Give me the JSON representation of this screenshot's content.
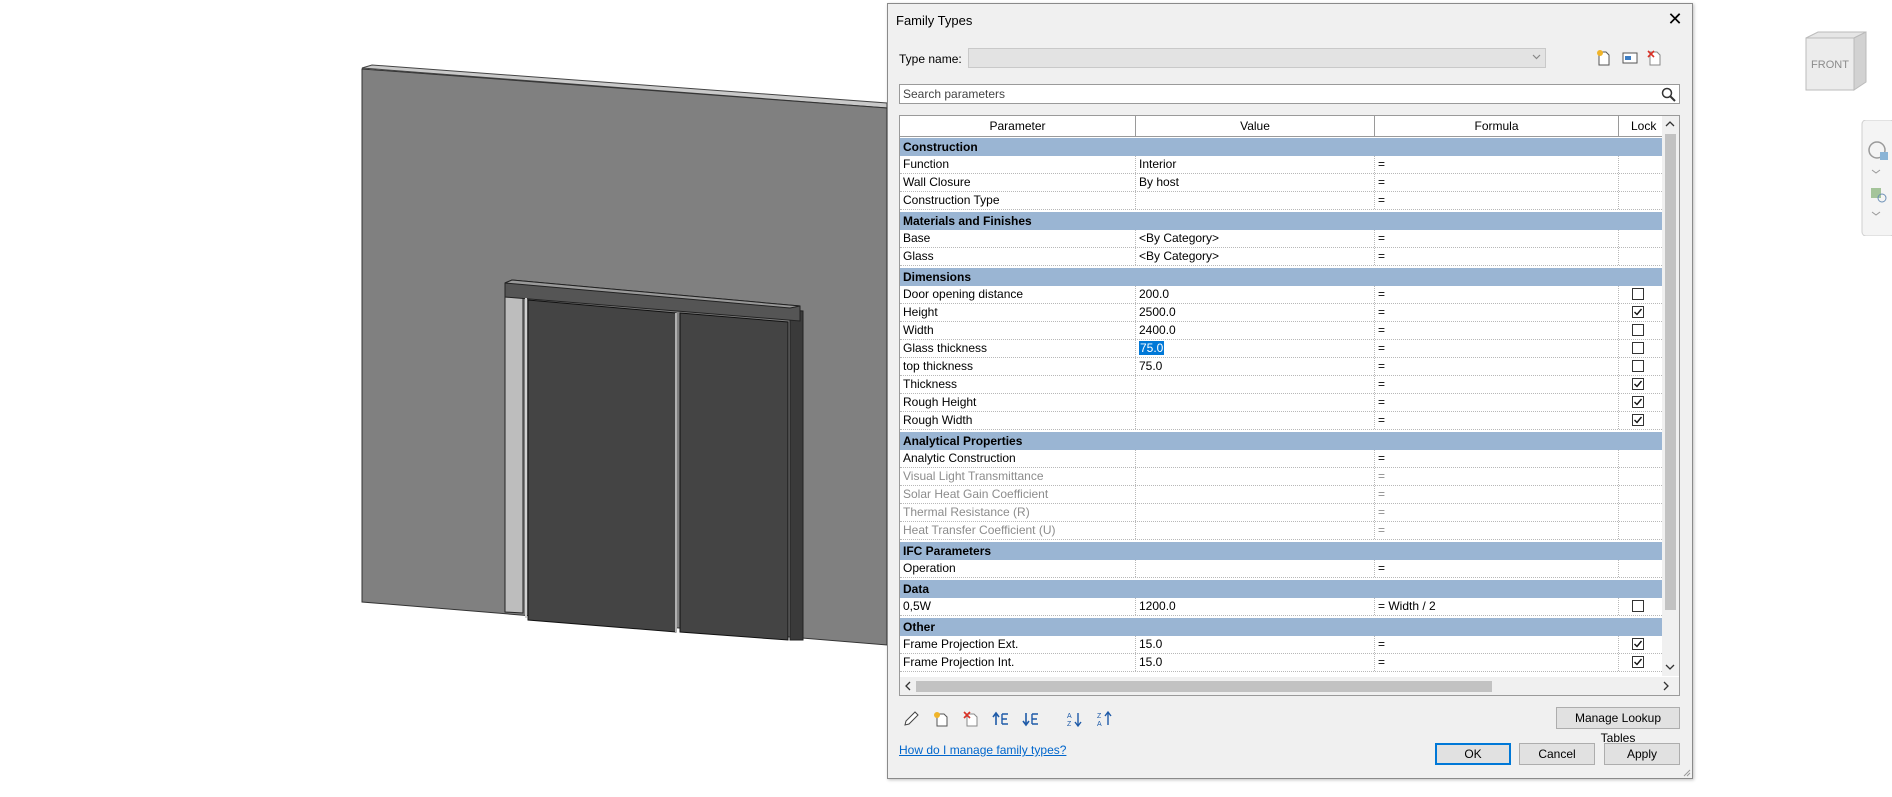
{
  "dialog": {
    "title": "Family Types",
    "type_name_label": "Type name:",
    "type_name_value": "",
    "search_placeholder": "Search parameters"
  },
  "table": {
    "columns": [
      "Parameter",
      "Value",
      "Formula",
      "Lock"
    ],
    "groups": [
      {
        "name": "Construction",
        "rows": [
          {
            "parameter": "Function",
            "value": "Interior",
            "formula": "=",
            "lock": null,
            "disabled": false
          },
          {
            "parameter": "Wall Closure",
            "value": "By host",
            "formula": "=",
            "lock": null,
            "disabled": false
          },
          {
            "parameter": "Construction Type",
            "value": "",
            "formula": "=",
            "lock": null,
            "disabled": false
          }
        ]
      },
      {
        "name": "Materials and Finishes",
        "rows": [
          {
            "parameter": "Base",
            "value": "<By Category>",
            "formula": "=",
            "lock": null,
            "disabled": false
          },
          {
            "parameter": "Glass",
            "value": "<By Category>",
            "formula": "=",
            "lock": null,
            "disabled": false
          }
        ]
      },
      {
        "name": "Dimensions",
        "rows": [
          {
            "parameter": "Door opening distance",
            "value": "200.0",
            "formula": "=",
            "lock": false,
            "disabled": false
          },
          {
            "parameter": "Height",
            "value": "2500.0",
            "formula": "=",
            "lock": true,
            "disabled": false
          },
          {
            "parameter": "Width",
            "value": "2400.0",
            "formula": "=",
            "lock": false,
            "disabled": false
          },
          {
            "parameter": "Glass thickness",
            "value": "75.0",
            "formula": "=",
            "lock": false,
            "disabled": false,
            "selected": true
          },
          {
            "parameter": "top thickness",
            "value": "75.0",
            "formula": "=",
            "lock": false,
            "disabled": false
          },
          {
            "parameter": "Thickness",
            "value": "",
            "formula": "=",
            "lock": true,
            "disabled": false
          },
          {
            "parameter": "Rough Height",
            "value": "",
            "formula": "=",
            "lock": true,
            "disabled": false
          },
          {
            "parameter": "Rough Width",
            "value": "",
            "formula": "=",
            "lock": true,
            "disabled": false
          }
        ]
      },
      {
        "name": "Analytical Properties",
        "rows": [
          {
            "parameter": "Analytic Construction",
            "value": "",
            "formula": "=",
            "lock": null,
            "disabled": false
          },
          {
            "parameter": "Visual Light Transmittance",
            "value": "",
            "formula": "=",
            "lock": null,
            "disabled": true
          },
          {
            "parameter": "Solar Heat Gain Coefficient",
            "value": "",
            "formula": "=",
            "lock": null,
            "disabled": true
          },
          {
            "parameter": "Thermal Resistance (R)",
            "value": "",
            "formula": "=",
            "lock": null,
            "disabled": true
          },
          {
            "parameter": "Heat Transfer Coefficient (U)",
            "value": "",
            "formula": "=",
            "lock": null,
            "disabled": true
          }
        ]
      },
      {
        "name": "IFC Parameters",
        "rows": [
          {
            "parameter": "Operation",
            "value": "",
            "formula": "=",
            "lock": null,
            "disabled": false
          }
        ]
      },
      {
        "name": "Data",
        "rows": [
          {
            "parameter": "0,5W",
            "value": "1200.0",
            "formula": "= Width / 2",
            "lock": false,
            "disabled": false
          }
        ]
      },
      {
        "name": "Other",
        "rows": [
          {
            "parameter": "Frame Projection Ext.",
            "value": "15.0",
            "formula": "=",
            "lock": true,
            "disabled": false
          },
          {
            "parameter": "Frame Projection Int.",
            "value": "15.0",
            "formula": "=",
            "lock": true,
            "disabled": false
          }
        ]
      }
    ]
  },
  "buttons": {
    "manage_lookup": "Manage Lookup Tables",
    "ok": "OK",
    "cancel": "Cancel",
    "apply": "Apply",
    "help_link": "How do I manage family types?"
  },
  "view_cube": {
    "label": "FRONT"
  },
  "colors": {
    "group_header": "#9ab5d3",
    "selection": "#0078d7",
    "link": "#0066cc"
  }
}
